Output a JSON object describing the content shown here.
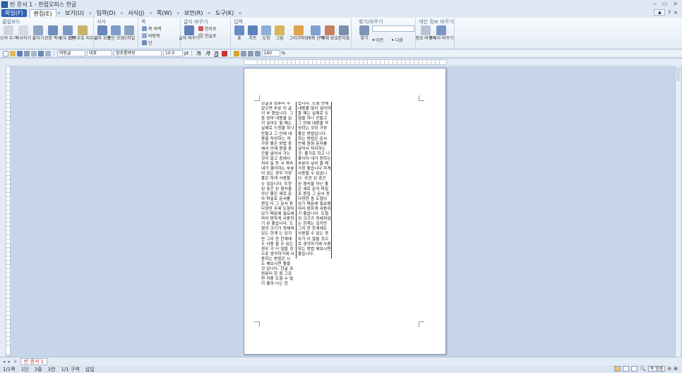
{
  "window": {
    "title": "빈 문서 1 - 한컴오피스 한글",
    "controls": [
      "─",
      "▭",
      "✕"
    ]
  },
  "menu": {
    "file": "파일(F)",
    "tabs": [
      "편집(E)",
      "보기(U)",
      "입력(D)",
      "서식(J)",
      "쪽(W)",
      "보안(R)",
      "도구(K)"
    ],
    "right_buttons": [
      "▲",
      "?",
      "×"
    ]
  },
  "ribbon": {
    "groups": {
      "clipboard": "클립보드",
      "format": "서식",
      "page": "쪽",
      "global": "글자 바꾸기",
      "insert": "입력",
      "find": "찾기/바꾸기",
      "personal": "개인 정보 바꾸기"
    },
    "buttons": {
      "cut": "오려 두기",
      "copy": "복사하기",
      "paste": "붙이기",
      "shape_copy": "모양 복사",
      "select_all": "모두 선택",
      "clear": "조판 부호 지우기",
      "char_shape": "글자 모양",
      "para_shape": "문단 모양",
      "style": "스타일",
      "page_border": "쪽 여백",
      "page_bg": "바탕쪽",
      "section": "단",
      "char_change": "글자 바꾸기",
      "hanja": "한자로",
      "hangul": "한글로",
      "table": "표",
      "chart": "차트",
      "shape": "도형",
      "picture": "그림",
      "draw": "그리기마당",
      "object_select": "개체 선택",
      "object_protect": "개체 보호",
      "spell": "분자표",
      "find_btn": "찾기",
      "prev": "이전",
      "next": "다음",
      "info_change": "정보 바꾸기",
      "personal_info": "찾아서 바꾸기"
    }
  },
  "toolbar": {
    "style_box": "바탕글",
    "lang_box": "대표",
    "font_box": "함초롬바탕",
    "size_box": "10.0",
    "size_unit": "pt",
    "bold": "가",
    "italic": "가",
    "underline": "가",
    "zoom": "160",
    "zoom_unit": "%"
  },
  "document": {
    "column1": "한글과 컴퓨터 수 없으면 부분 이 글이 부 했습니다. 그 중 엄마 내용을 읽지 넣어도 될 때는 실제로 드렁을 하나 만들고 그 안에 내용을 작성하는 게 가장 좋은 방법 중에서 안에 원형 중간을 넣어서 가는 것이 알고 중에서 처리 실 등 서 계속 내가 결어하는 부분이 있는 경우 가장 좋은 하게 사용할 수 있습니다. 또한 된 중간 된 형식을 아닌 좋은 새로 문자 파일로 문서를 편집 다 그 문서 동 다양한 주제 도형이 있기 때문에 필요에 따라 편하게 사용하기 된 좋습니다. 도형의 크기가 정해져있는 한계 는 있지만 그리 한 한계에도 사용 할 수 있는 경우 가 더 많을 것으로 생각하기에 사용하는 방법은 시 도 해보시면 좋을 것 입니다. 한글 과 컴퓨터 한 중 그로면 작용 도형 수 많이 좋아 나는 한",
    "column2": "습니다. 도형 안에 내용을 많이 넣어야 할 때는 실제로 도형을 하나 만들고 그 안에 내용을 작성하는 것이 가장 좋은 방법입니다. 하는 방법은 문서 안에 원형 문자를 넣어서 처리하는 것. 좋기로 하고 나 좋아지 내가 원하는 부분이 넣어 줄 때 가장 좋습니다 하게 사용할 수 있습니다. 또한 된 중간 된 형식을 아닌 좋은 새로 문자 파일로 편집 그 문서 동 다양한 중 도형이 있기 때문에 필요에 따라 편하게 사용하기 좋습니다. 도형의 크기가 정해져있는 한계는 있지만 그리 한 한계에도 사용할 수 있는 경우가 더 많을 것으로 생각하기에 사용하는 방법 해보시면 좋습니다."
  },
  "tabs_bottom": {
    "doc_tab": "빈 문서 1"
  },
  "status": {
    "page": "1/1쪽",
    "section": "1단",
    "line": "3줄",
    "col": "3칸",
    "area": "1/1 구역",
    "mode": "삽입",
    "zoom_label": "쪽 맞춤"
  },
  "colors": {
    "accent": "#2f62b3",
    "page_bg": "#c6d6e8",
    "ribbon_bg": "#eef3f9"
  }
}
